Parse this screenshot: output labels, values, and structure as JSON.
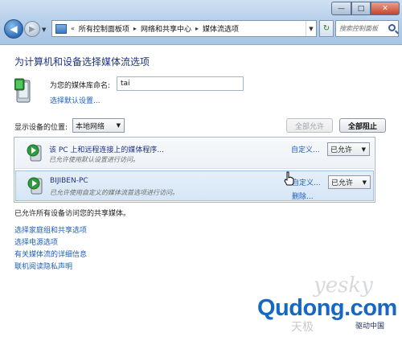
{
  "window": {
    "min_glyph": "—",
    "max_glyph": "□",
    "close_glyph": "✕"
  },
  "nav": {
    "back_glyph": "◀",
    "forward_glyph": "▶",
    "dropdown_glyph": "▼"
  },
  "address": {
    "prefix": "«",
    "crumbs": [
      "所有控制面板项",
      "网络和共享中心",
      "媒体流选项"
    ],
    "separator": "▸",
    "dropdown_glyph": "▼"
  },
  "refresh_glyph": "↻",
  "search": {
    "placeholder": "搜索控制面板"
  },
  "page_title": "为计算机和设备选择媒体流选项",
  "library": {
    "label": "为您的媒体库命名:",
    "value": "tai",
    "defaults_link": "选择默认设置..."
  },
  "location": {
    "label": "显示设备的位置:",
    "selected": "本地网络",
    "arrow": "▼"
  },
  "buttons": {
    "allow_all": "全部允许",
    "block_all": "全部阻止"
  },
  "devices": [
    {
      "name": "该 PC 上和远程连接上的媒体程序...",
      "desc": "已允许使用默认设置进行访问。",
      "customize": "自定义...",
      "remove": "",
      "status": "已允许"
    },
    {
      "name": "BIJIBEN-PC",
      "desc": "已允许使用自定义的媒体流首选项进行访问。",
      "customize": "自定义...",
      "remove": "删除...",
      "status": "已允许"
    }
  ],
  "select_arrow": "▼",
  "allowed_note": "已允许所有设备访问您的共享媒体。",
  "links": [
    "选择家庭组和共享选项",
    "选择电源选项",
    "有关媒体流的详细信息",
    "联机阅读隐私声明"
  ],
  "watermark": {
    "yesky": "yesky",
    "brand": "Qudong.com",
    "sub_left": "天极",
    "sub_right": "驱动中国"
  },
  "colors": {
    "title": "#1e3287",
    "link": "#1f5fb8",
    "brand": "#1569c4"
  }
}
